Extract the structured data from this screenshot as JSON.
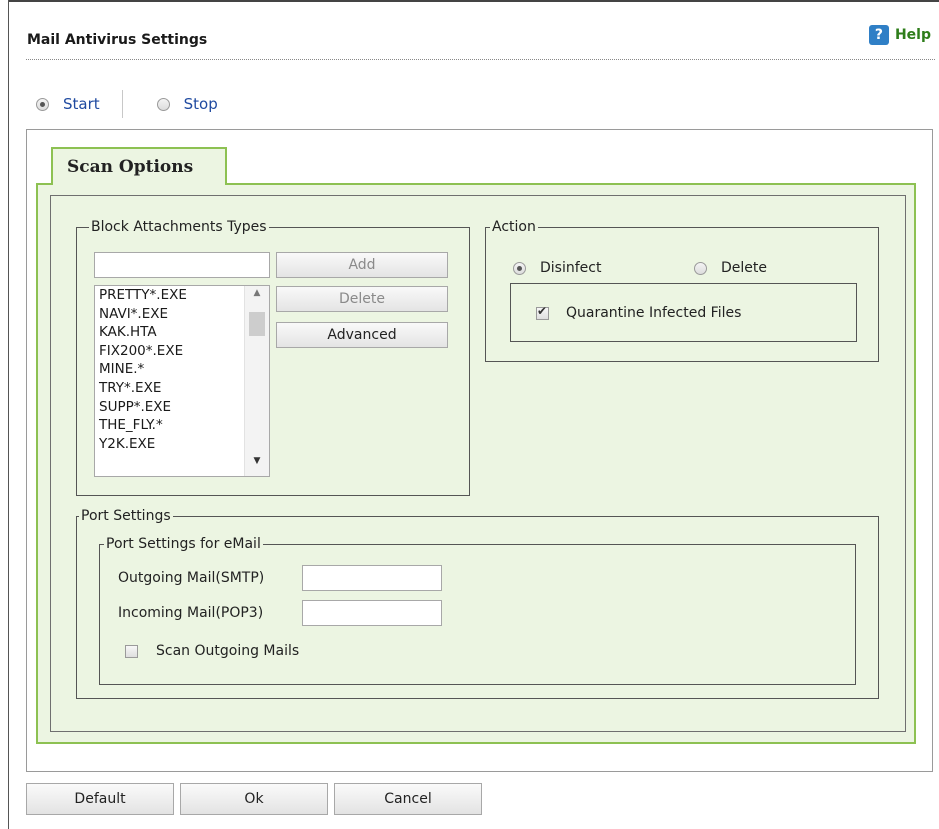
{
  "header": {
    "title": "Mail Antivirus Settings",
    "help_label": "Help",
    "help_icon": "help-icon"
  },
  "service": {
    "start_label": "Start",
    "stop_label": "Stop",
    "selected": "Start"
  },
  "tab": {
    "label": "Scan Options"
  },
  "block_attachments": {
    "legend": "Block Attachments Types",
    "input_value": "",
    "add_label": "Add",
    "delete_label": "Delete",
    "advanced_label": "Advanced",
    "items": [
      "PRETTY*.EXE",
      "NAVI*.EXE",
      "KAK.HTA",
      "FIX200*.EXE",
      "MINE.*",
      "TRY*.EXE",
      "SUPP*.EXE",
      "THE_FLY.*",
      "Y2K.EXE"
    ]
  },
  "action": {
    "legend": "Action",
    "disinfect_label": "Disinfect",
    "delete_label": "Delete",
    "selected": "Disinfect",
    "quarantine_label": "Quarantine Infected Files",
    "quarantine_checked": true
  },
  "port_settings": {
    "legend": "Port Settings",
    "email_legend": "Port Settings for eMail",
    "outgoing_label": "Outgoing Mail(SMTP)",
    "outgoing_value": "",
    "incoming_label": "Incoming Mail(POP3)",
    "incoming_value": "",
    "scan_outgoing_label": "Scan Outgoing Mails",
    "scan_outgoing_checked": false
  },
  "footer": {
    "default_label": "Default",
    "ok_label": "Ok",
    "cancel_label": "Cancel"
  }
}
